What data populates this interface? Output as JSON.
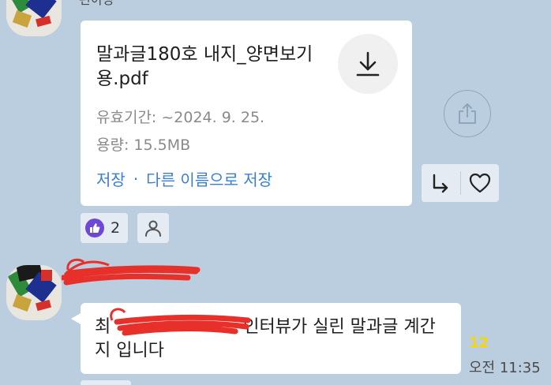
{
  "top_sender": {
    "name": "편이정"
  },
  "file_message": {
    "file_name": "말과글180호 내지_양면보기용.pdf",
    "validity": "유효기간: ~2024. 9. 25.",
    "size": "용량: 15.5MB",
    "save_label": "저장",
    "separator": "·",
    "save_as_label": "다른 이름으로 저장"
  },
  "reactions": {
    "like_count": "2"
  },
  "text_message": {
    "text_visible_start": "최",
    "text_visible_end": "인터뷰가 실린 말과글 계간지 입니다",
    "unread_count": "12",
    "time": "오전 11:35"
  },
  "colors": {
    "chat_background": "#bacee0",
    "link_blue": "#3a7fcf",
    "unread_yellow": "#f5d60a",
    "like_purple": "#6f47d6",
    "redaction_red": "#e8302a"
  },
  "icons": {
    "download": "download-icon",
    "share": "share-icon",
    "reply": "reply-icon",
    "heart": "heart-icon",
    "thumbs_up": "thumbs-up-icon",
    "person": "person-icon"
  }
}
